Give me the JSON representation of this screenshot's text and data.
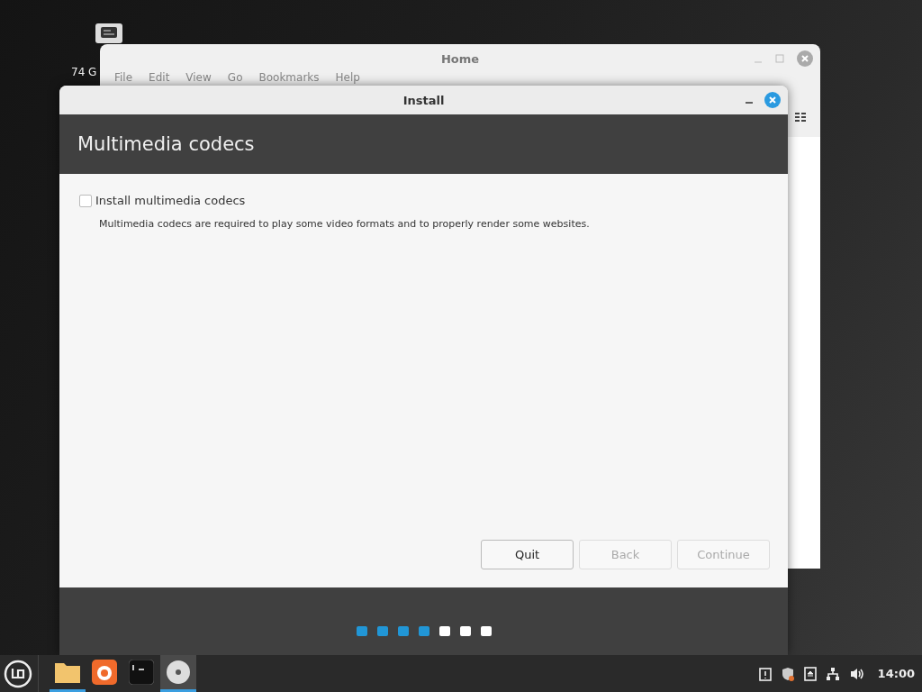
{
  "desktop": {
    "icons": [
      {
        "label": "74 G"
      }
    ]
  },
  "home_window": {
    "title": "Home",
    "menu": [
      "File",
      "Edit",
      "View",
      "Go",
      "Bookmarks",
      "Help"
    ]
  },
  "dialog": {
    "title": "Install",
    "heading": "Multimedia codecs",
    "option": {
      "label": "Install multimedia codecs",
      "checked": false
    },
    "description": "Multimedia codecs are required to play some video formats and to properly render some websites.",
    "buttons": [
      {
        "label": "Quit",
        "disabled": false
      },
      {
        "label": "Back",
        "disabled": true
      },
      {
        "label": "Continue",
        "disabled": true
      }
    ],
    "steps": [
      {
        "done": true
      },
      {
        "done": true
      },
      {
        "done": true
      },
      {
        "done": true
      },
      {
        "done": false
      },
      {
        "done": false
      },
      {
        "done": false
      }
    ]
  },
  "taskbar": {
    "apps": [
      {
        "kind": "folder",
        "running": true,
        "selected": false
      },
      {
        "kind": "browser",
        "running": false,
        "selected": false
      },
      {
        "kind": "terminal",
        "running": false,
        "selected": false
      },
      {
        "kind": "disc",
        "running": true,
        "selected": true
      }
    ],
    "tray": [
      {
        "kind": "clipboard"
      },
      {
        "kind": "shield"
      },
      {
        "kind": "eject"
      },
      {
        "kind": "network"
      },
      {
        "kind": "volume"
      }
    ],
    "clock": "14:00"
  }
}
